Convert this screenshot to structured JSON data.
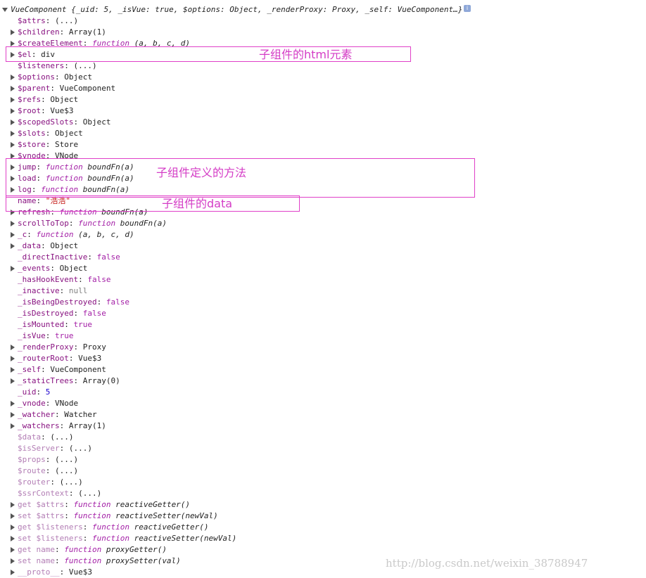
{
  "header": {
    "label": "VueComponent {_uid: 5, _isVue: true, $options: Object, _renderProxy: Proxy, _self: VueComponent…}",
    "info_icon": "info-icon"
  },
  "rows": [
    {
      "arrow": false,
      "parts": [
        [
          "k",
          "$attrs"
        ],
        [
          "s",
          ": "
        ],
        [
          "v",
          "(...)"
        ]
      ]
    },
    {
      "arrow": true,
      "parts": [
        [
          "k",
          "$children"
        ],
        [
          "s",
          ": "
        ],
        [
          "v",
          "Array(1)"
        ]
      ]
    },
    {
      "arrow": true,
      "parts": [
        [
          "k",
          "$createElement"
        ],
        [
          "s",
          ": "
        ],
        [
          "f",
          "function"
        ],
        [
          "v",
          " "
        ],
        [
          "fn",
          "(a, b, c, d)"
        ]
      ]
    },
    {
      "arrow": true,
      "parts": [
        [
          "k",
          "$el"
        ],
        [
          "s",
          ": "
        ],
        [
          "v",
          "div"
        ]
      ]
    },
    {
      "arrow": false,
      "parts": [
        [
          "k",
          "$listeners"
        ],
        [
          "s",
          ": "
        ],
        [
          "v",
          "(...)"
        ]
      ]
    },
    {
      "arrow": true,
      "parts": [
        [
          "k",
          "$options"
        ],
        [
          "s",
          ": "
        ],
        [
          "v",
          "Object"
        ]
      ]
    },
    {
      "arrow": true,
      "parts": [
        [
          "k",
          "$parent"
        ],
        [
          "s",
          ": "
        ],
        [
          "v",
          "VueComponent"
        ]
      ]
    },
    {
      "arrow": true,
      "parts": [
        [
          "k",
          "$refs"
        ],
        [
          "s",
          ": "
        ],
        [
          "v",
          "Object"
        ]
      ]
    },
    {
      "arrow": true,
      "parts": [
        [
          "k",
          "$root"
        ],
        [
          "s",
          ": "
        ],
        [
          "v",
          "Vue$3"
        ]
      ]
    },
    {
      "arrow": true,
      "parts": [
        [
          "k",
          "$scopedSlots"
        ],
        [
          "s",
          ": "
        ],
        [
          "v",
          "Object"
        ]
      ]
    },
    {
      "arrow": true,
      "parts": [
        [
          "k",
          "$slots"
        ],
        [
          "s",
          ": "
        ],
        [
          "v",
          "Object"
        ]
      ]
    },
    {
      "arrow": true,
      "parts": [
        [
          "k",
          "$store"
        ],
        [
          "s",
          ": "
        ],
        [
          "v",
          "Store"
        ]
      ]
    },
    {
      "arrow": true,
      "parts": [
        [
          "k",
          "$vnode"
        ],
        [
          "s",
          ": "
        ],
        [
          "v",
          "VNode"
        ]
      ]
    },
    {
      "arrow": true,
      "parts": [
        [
          "k",
          "jump"
        ],
        [
          "s",
          ": "
        ],
        [
          "f",
          "function"
        ],
        [
          "v",
          " "
        ],
        [
          "fn",
          "boundFn(a)"
        ]
      ]
    },
    {
      "arrow": true,
      "parts": [
        [
          "k",
          "load"
        ],
        [
          "s",
          ": "
        ],
        [
          "f",
          "function"
        ],
        [
          "v",
          " "
        ],
        [
          "fn",
          "boundFn(a)"
        ]
      ]
    },
    {
      "arrow": true,
      "parts": [
        [
          "k",
          "log"
        ],
        [
          "s",
          ": "
        ],
        [
          "f",
          "function"
        ],
        [
          "v",
          " "
        ],
        [
          "fn",
          "boundFn(a)"
        ]
      ]
    },
    {
      "arrow": false,
      "parts": [
        [
          "k",
          "name"
        ],
        [
          "s",
          ": "
        ],
        [
          "str",
          "\"浩浩\""
        ]
      ]
    },
    {
      "arrow": true,
      "parts": [
        [
          "k",
          "refresh"
        ],
        [
          "s",
          ": "
        ],
        [
          "f",
          "function"
        ],
        [
          "v",
          " "
        ],
        [
          "fn",
          "boundFn(a)"
        ]
      ]
    },
    {
      "arrow": true,
      "parts": [
        [
          "k",
          "scrollToTop"
        ],
        [
          "s",
          ": "
        ],
        [
          "f",
          "function"
        ],
        [
          "v",
          " "
        ],
        [
          "fn",
          "boundFn(a)"
        ]
      ]
    },
    {
      "arrow": true,
      "parts": [
        [
          "k",
          "_c"
        ],
        [
          "s",
          ": "
        ],
        [
          "f",
          "function"
        ],
        [
          "v",
          " "
        ],
        [
          "fn",
          "(a, b, c, d)"
        ]
      ]
    },
    {
      "arrow": true,
      "parts": [
        [
          "k",
          "_data"
        ],
        [
          "s",
          ": "
        ],
        [
          "v",
          "Object"
        ]
      ]
    },
    {
      "arrow": false,
      "parts": [
        [
          "k",
          "_directInactive"
        ],
        [
          "s",
          ": "
        ],
        [
          "b",
          "false"
        ]
      ]
    },
    {
      "arrow": true,
      "parts": [
        [
          "k",
          "_events"
        ],
        [
          "s",
          ": "
        ],
        [
          "v",
          "Object"
        ]
      ]
    },
    {
      "arrow": false,
      "parts": [
        [
          "k",
          "_hasHookEvent"
        ],
        [
          "s",
          ": "
        ],
        [
          "b",
          "false"
        ]
      ]
    },
    {
      "arrow": false,
      "parts": [
        [
          "k",
          "_inactive"
        ],
        [
          "s",
          ": "
        ],
        [
          "n",
          "null"
        ]
      ]
    },
    {
      "arrow": false,
      "parts": [
        [
          "k",
          "_isBeingDestroyed"
        ],
        [
          "s",
          ": "
        ],
        [
          "b",
          "false"
        ]
      ]
    },
    {
      "arrow": false,
      "parts": [
        [
          "k",
          "_isDestroyed"
        ],
        [
          "s",
          ": "
        ],
        [
          "b",
          "false"
        ]
      ]
    },
    {
      "arrow": false,
      "parts": [
        [
          "k",
          "_isMounted"
        ],
        [
          "s",
          ": "
        ],
        [
          "b",
          "true"
        ]
      ]
    },
    {
      "arrow": false,
      "parts": [
        [
          "k",
          "_isVue"
        ],
        [
          "s",
          ": "
        ],
        [
          "b",
          "true"
        ]
      ]
    },
    {
      "arrow": true,
      "parts": [
        [
          "k",
          "_renderProxy"
        ],
        [
          "s",
          ": "
        ],
        [
          "v",
          "Proxy"
        ]
      ]
    },
    {
      "arrow": true,
      "parts": [
        [
          "k",
          "_routerRoot"
        ],
        [
          "s",
          ": "
        ],
        [
          "v",
          "Vue$3"
        ]
      ]
    },
    {
      "arrow": true,
      "parts": [
        [
          "k",
          "_self"
        ],
        [
          "s",
          ": "
        ],
        [
          "v",
          "VueComponent"
        ]
      ]
    },
    {
      "arrow": true,
      "parts": [
        [
          "k",
          "_staticTrees"
        ],
        [
          "s",
          ": "
        ],
        [
          "v",
          "Array(0)"
        ]
      ]
    },
    {
      "arrow": false,
      "parts": [
        [
          "k",
          "_uid"
        ],
        [
          "s",
          ": "
        ],
        [
          "num",
          "5"
        ]
      ]
    },
    {
      "arrow": true,
      "parts": [
        [
          "k",
          "_vnode"
        ],
        [
          "s",
          ": "
        ],
        [
          "v",
          "VNode"
        ]
      ]
    },
    {
      "arrow": true,
      "parts": [
        [
          "k",
          "_watcher"
        ],
        [
          "s",
          ": "
        ],
        [
          "v",
          "Watcher"
        ]
      ]
    },
    {
      "arrow": true,
      "parts": [
        [
          "k",
          "_watchers"
        ],
        [
          "s",
          ": "
        ],
        [
          "v",
          "Array(1)"
        ]
      ]
    },
    {
      "arrow": false,
      "parts": [
        [
          "kd",
          "$data"
        ],
        [
          "s",
          ": "
        ],
        [
          "v",
          "(...)"
        ]
      ]
    },
    {
      "arrow": false,
      "parts": [
        [
          "kd",
          "$isServer"
        ],
        [
          "s",
          ": "
        ],
        [
          "v",
          "(...)"
        ]
      ]
    },
    {
      "arrow": false,
      "parts": [
        [
          "kd",
          "$props"
        ],
        [
          "s",
          ": "
        ],
        [
          "v",
          "(...)"
        ]
      ]
    },
    {
      "arrow": false,
      "parts": [
        [
          "kd",
          "$route"
        ],
        [
          "s",
          ": "
        ],
        [
          "v",
          "(...)"
        ]
      ]
    },
    {
      "arrow": false,
      "parts": [
        [
          "kd",
          "$router"
        ],
        [
          "s",
          ": "
        ],
        [
          "v",
          "(...)"
        ]
      ]
    },
    {
      "arrow": false,
      "parts": [
        [
          "kd",
          "$ssrContext"
        ],
        [
          "s",
          ": "
        ],
        [
          "v",
          "(...)"
        ]
      ]
    },
    {
      "arrow": true,
      "parts": [
        [
          "kd",
          "get $attrs"
        ],
        [
          "s",
          ": "
        ],
        [
          "f",
          "function"
        ],
        [
          "v",
          " "
        ],
        [
          "fn",
          "reactiveGetter()"
        ]
      ]
    },
    {
      "arrow": true,
      "parts": [
        [
          "kd",
          "set $attrs"
        ],
        [
          "s",
          ": "
        ],
        [
          "f",
          "function"
        ],
        [
          "v",
          " "
        ],
        [
          "fn",
          "reactiveSetter(newVal)"
        ]
      ]
    },
    {
      "arrow": true,
      "parts": [
        [
          "kd",
          "get $listeners"
        ],
        [
          "s",
          ": "
        ],
        [
          "f",
          "function"
        ],
        [
          "v",
          " "
        ],
        [
          "fn",
          "reactiveGetter()"
        ]
      ]
    },
    {
      "arrow": true,
      "parts": [
        [
          "kd",
          "set $listeners"
        ],
        [
          "s",
          ": "
        ],
        [
          "f",
          "function"
        ],
        [
          "v",
          " "
        ],
        [
          "fn",
          "reactiveSetter(newVal)"
        ]
      ]
    },
    {
      "arrow": true,
      "parts": [
        [
          "kd",
          "get name"
        ],
        [
          "s",
          ": "
        ],
        [
          "f",
          "function"
        ],
        [
          "v",
          " "
        ],
        [
          "fn",
          "proxyGetter()"
        ]
      ]
    },
    {
      "arrow": true,
      "parts": [
        [
          "kd",
          "set name"
        ],
        [
          "s",
          ": "
        ],
        [
          "f",
          "function"
        ],
        [
          "v",
          " "
        ],
        [
          "fn",
          "proxySetter(val)"
        ]
      ]
    },
    {
      "arrow": true,
      "parts": [
        [
          "kd",
          "__proto__"
        ],
        [
          "s",
          ": "
        ],
        [
          "v",
          "Vue$3"
        ]
      ]
    }
  ],
  "annotations": {
    "el_note": "子组件的html元素",
    "methods_note": "子组件定义的方法",
    "data_note": "子组件的data"
  },
  "watermark": "http://blog.csdn.net/weixin_38788947"
}
